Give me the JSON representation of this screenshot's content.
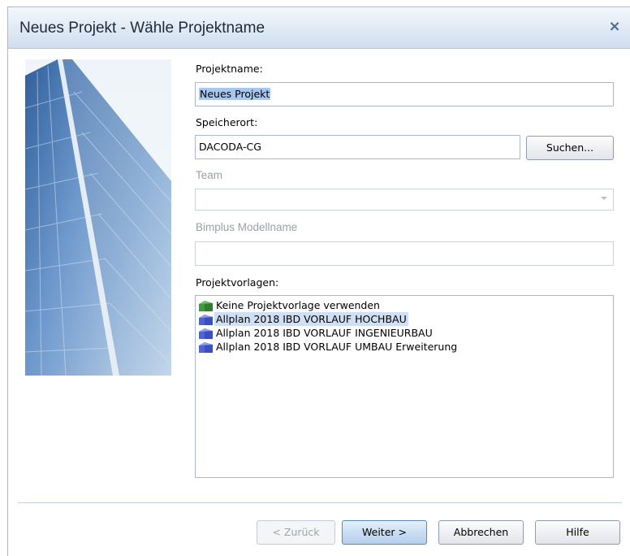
{
  "window": {
    "title": "Neues Projekt - Wähle Projektname",
    "close_glyph": "×"
  },
  "form": {
    "project_name_label": "Projektname:",
    "project_name_value": "Neues Projekt",
    "location_label": "Speicherort:",
    "location_value": "DACODA-CG",
    "search_button": "Suchen...",
    "team_label": "Team",
    "team_value": "",
    "bimplus_label": "Bimplus Modellname",
    "bimplus_value": "",
    "templates_label": "Projektvorlagen:"
  },
  "templates": [
    {
      "label": "Keine Projektvorlage verwenden",
      "icon": "green-building-icon",
      "selected": false
    },
    {
      "label": "Allplan 2018 IBD VORLAUF HOCHBAU",
      "icon": "blue-building-icon",
      "selected": true
    },
    {
      "label": "Allplan 2018 IBD VORLAUF INGENIEURBAU",
      "icon": "blue-building-icon",
      "selected": false
    },
    {
      "label": "Allplan 2018 IBD VORLAUF UMBAU Erweiterung",
      "icon": "blue-building-icon",
      "selected": false
    }
  ],
  "buttons": {
    "back": "< Zurück",
    "next": "Weiter >",
    "cancel": "Abbrechen",
    "help": "Hilfe"
  },
  "colors": {
    "selection": "#cfe0f5",
    "text_selection": "#a9c6ee",
    "primary_button": "#c9def3",
    "icon_green": "#3f9a3f",
    "icon_blue": "#3a4fc0"
  }
}
